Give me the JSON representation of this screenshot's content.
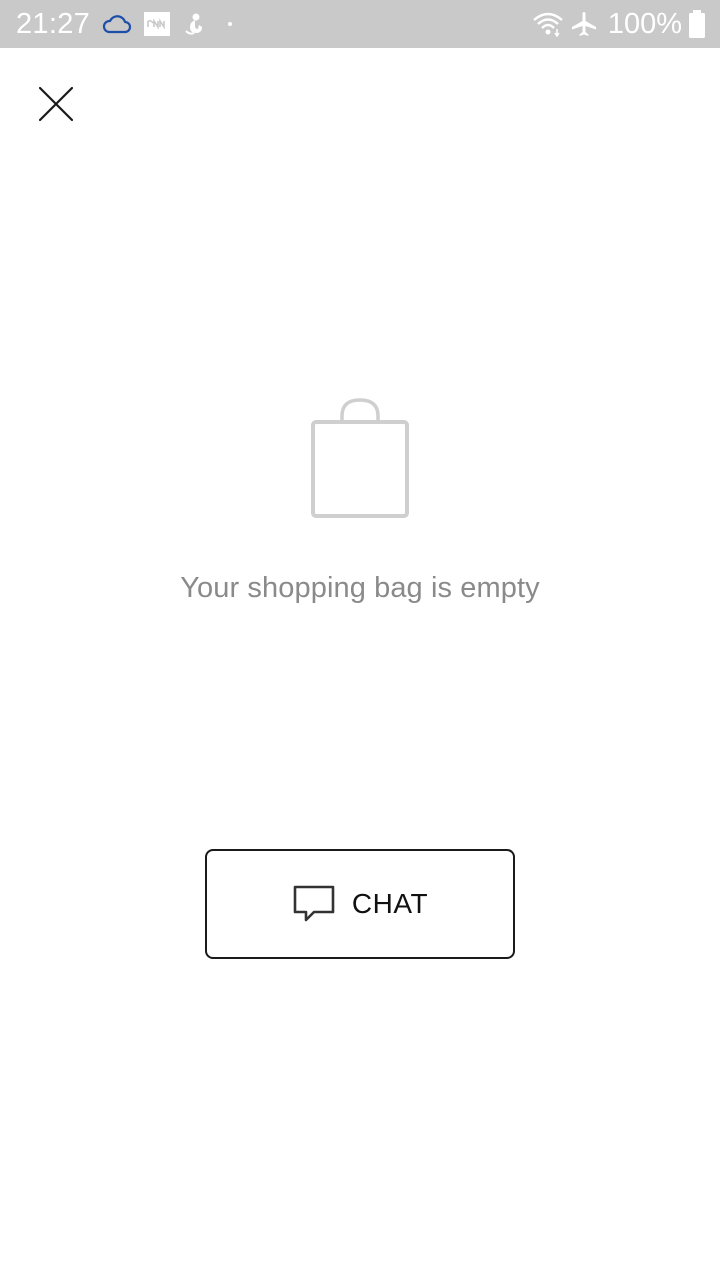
{
  "status_bar": {
    "time": "21:27",
    "battery_text": "100%",
    "icons": [
      "cloud-icon",
      "cnn-app-icon",
      "bird-notification-icon",
      "dot-icon",
      "wifi-icon",
      "airplane-mode-icon",
      "battery-icon"
    ],
    "cloud_color": "#1d4fa8"
  },
  "header": {
    "close_icon": "close-icon"
  },
  "empty_state": {
    "icon": "shopping-bag-icon",
    "message": "Your shopping bag is empty"
  },
  "chat_button": {
    "icon": "chat-bubble-icon",
    "label": "CHAT"
  }
}
